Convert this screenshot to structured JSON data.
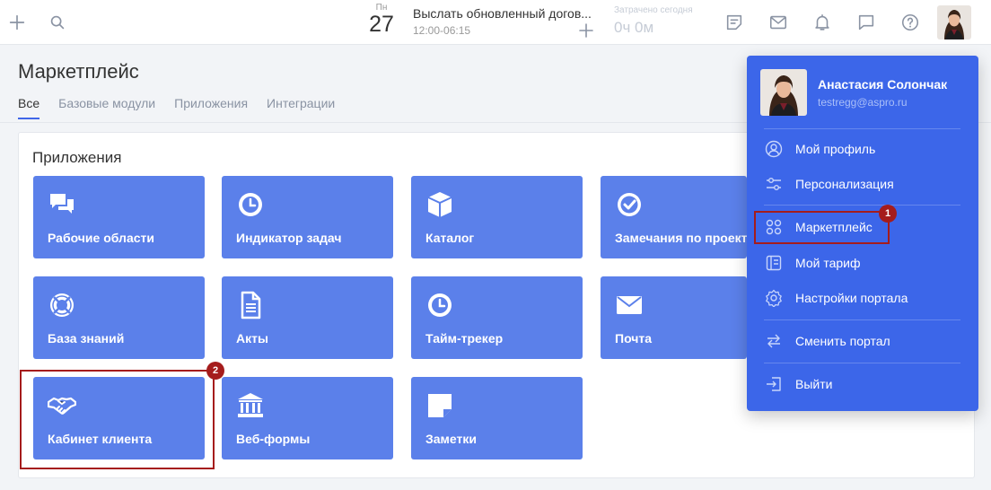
{
  "topbar": {
    "date": {
      "dow": "Пн",
      "day": "27"
    },
    "event": {
      "title": "Выслать обновленный догов...",
      "time": "12:00-06:15"
    },
    "spent": {
      "label": "Затрачено сегодня",
      "value": "0ч 0м"
    }
  },
  "header": {
    "title": "Маркетплейс",
    "tabs": [
      {
        "label": "Все"
      },
      {
        "label": "Базовые модули"
      },
      {
        "label": "Приложения"
      },
      {
        "label": "Интеграции"
      }
    ]
  },
  "apps": {
    "section_title": "Приложения",
    "tiles": [
      {
        "label": "Рабочие области",
        "icon": "chat-bubbles-icon"
      },
      {
        "label": "Индикатор задач",
        "icon": "clock-icon"
      },
      {
        "label": "Каталог",
        "icon": "box-icon"
      },
      {
        "label": "Замечания по проектам",
        "icon": "check-circle-icon"
      },
      {
        "label": "База знаний",
        "icon": "lifebuoy-icon"
      },
      {
        "label": "Акты",
        "icon": "document-icon"
      },
      {
        "label": "Тайм-трекер",
        "icon": "clock-icon"
      },
      {
        "label": "Почта",
        "icon": "envelope-icon"
      },
      {
        "label": "Кабинет клиента",
        "icon": "handshake-icon"
      },
      {
        "label": "Веб-формы",
        "icon": "bank-icon"
      },
      {
        "label": "Заметки",
        "icon": "note-icon"
      }
    ]
  },
  "user_menu": {
    "name": "Анастасия Солончак",
    "email": "testregg@aspro.ru",
    "items": [
      {
        "label": "Мой профиль",
        "icon": "user-circle-icon"
      },
      {
        "label": "Персонализация",
        "icon": "sliders-icon"
      },
      {
        "label": "Маркетплейс",
        "icon": "grid-circles-icon"
      },
      {
        "label": "Мой тариф",
        "icon": "tariff-icon"
      },
      {
        "label": "Настройки портала",
        "icon": "gear-icon"
      },
      {
        "label": "Сменить портал",
        "icon": "swap-arrows-icon"
      },
      {
        "label": "Выйти",
        "icon": "logout-icon"
      }
    ]
  },
  "annotations": {
    "badge_1": "1",
    "badge_2": "2"
  },
  "colors": {
    "accent": "#3c66e9",
    "tile": "#5b80ea",
    "highlight": "#a51c1c"
  }
}
